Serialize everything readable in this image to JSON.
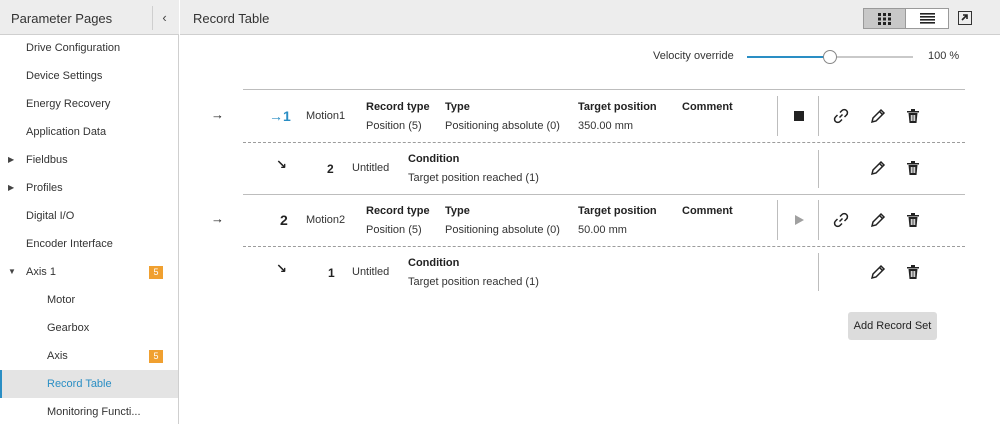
{
  "sidebar": {
    "title": "Parameter Pages",
    "collapse_glyph": "‹",
    "items": [
      {
        "label": "Drive Configuration"
      },
      {
        "label": "Device Settings"
      },
      {
        "label": "Energy Recovery"
      },
      {
        "label": "Application Data"
      },
      {
        "label": "Fieldbus"
      },
      {
        "label": "Profiles"
      },
      {
        "label": "Digital I/O"
      },
      {
        "label": "Encoder Interface"
      },
      {
        "label": "Axis 1",
        "badge": "5"
      },
      {
        "label": "Motor"
      },
      {
        "label": "Gearbox"
      },
      {
        "label": "Axis",
        "badge": "5"
      },
      {
        "label": "Record Table"
      },
      {
        "label": "Monitoring Functi..."
      }
    ]
  },
  "header": {
    "title": "Record Table"
  },
  "velocity": {
    "label": "Velocity override",
    "value_text": "100 %",
    "fraction": 0.5
  },
  "records": [
    {
      "arrow": "→",
      "number": "→1",
      "name": "Motion1",
      "record_type_label": "Record type",
      "record_type_value": "Position (5)",
      "type_label": "Type",
      "type_value": "Positioning absolute (0)",
      "target_label": "Target position",
      "target_value": "350.00 mm",
      "comment_label": "Comment",
      "step": {
        "glyph": "↘",
        "number": "2",
        "name": "Untitled",
        "condition_label": "Condition",
        "condition_value": "Target position reached (1)"
      }
    },
    {
      "arrow": "→",
      "number": "2",
      "name": "Motion2",
      "record_type_label": "Record type",
      "record_type_value": "Position (5)",
      "type_label": "Type",
      "type_value": "Positioning absolute (0)",
      "target_label": "Target position",
      "target_value": "50.00 mm",
      "comment_label": "Comment",
      "step": {
        "glyph": "↘",
        "number": "1",
        "name": "Untitled",
        "condition_label": "Condition",
        "condition_value": "Target position reached (1)"
      }
    }
  ],
  "add_button_label": "Add Record Set",
  "icons": {
    "stop": "stop-icon",
    "play": "play-icon",
    "link": "link-icon",
    "edit": "pencil-icon",
    "delete": "trash-icon"
  },
  "colors": {
    "accent": "#2a8ec4",
    "badge": "#f0a030"
  }
}
